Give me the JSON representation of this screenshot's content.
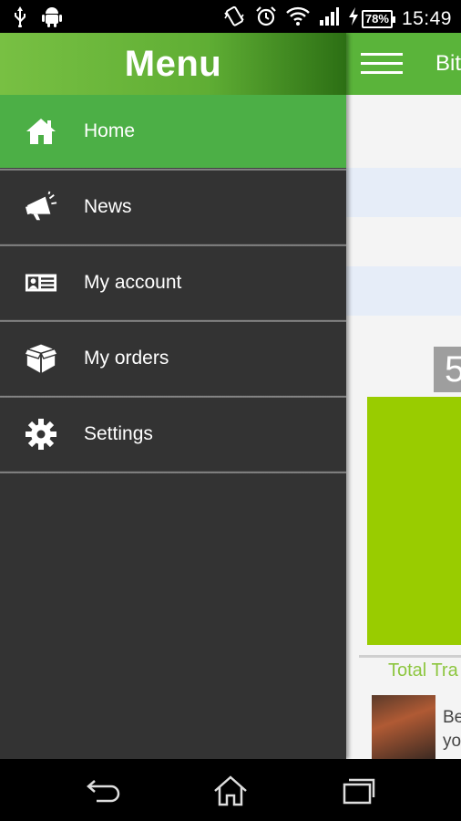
{
  "status_bar": {
    "time": "15:49",
    "battery": "78%",
    "icons": [
      "usb-icon",
      "android-icon",
      "vibrate-icon",
      "alarm-icon",
      "wifi-icon",
      "signal-icon",
      "charging-icon"
    ]
  },
  "app": {
    "title": "Bit",
    "badge_value": "5",
    "chart_label": "Total Tra",
    "ad_text_line1": "Be",
    "ad_text_line2": "yo"
  },
  "drawer": {
    "title": "Menu",
    "items": [
      {
        "label": "Home",
        "icon": "home-icon",
        "active": true
      },
      {
        "label": "News",
        "icon": "megaphone-icon",
        "active": false
      },
      {
        "label": "My account",
        "icon": "id-card-icon",
        "active": false
      },
      {
        "label": "My orders",
        "icon": "box-icon",
        "active": false
      },
      {
        "label": "Settings",
        "icon": "gear-icon",
        "active": false
      }
    ]
  },
  "colors": {
    "accent_green": "#4caf46",
    "drawer_bg": "#333333",
    "chart_green": "#99cc00"
  },
  "nav_bar": {
    "buttons": [
      "back-icon",
      "home-icon",
      "recent-apps-icon"
    ]
  }
}
